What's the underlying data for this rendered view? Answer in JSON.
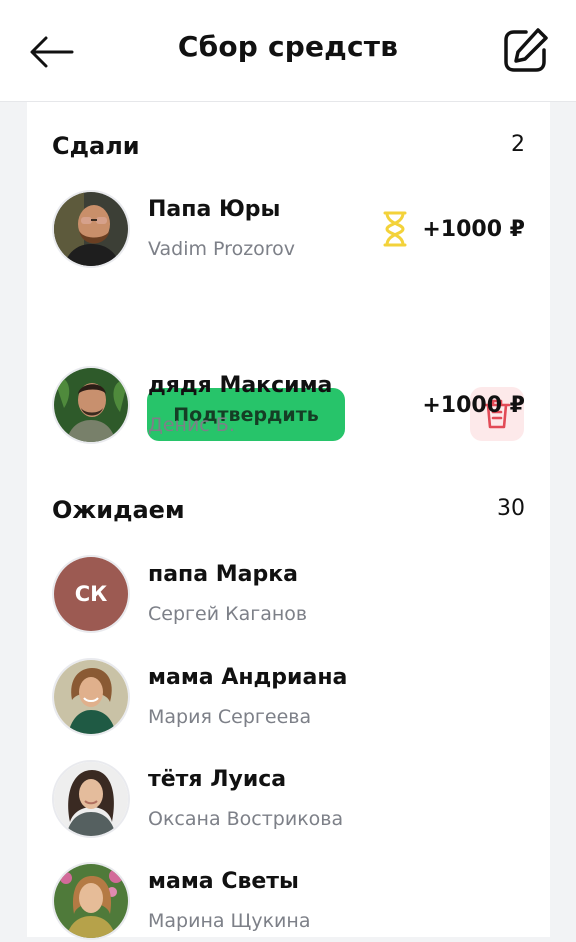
{
  "header": {
    "title": "Сбор средств",
    "back_icon": "arrow-left-icon",
    "edit_icon": "edit-icon"
  },
  "sections": {
    "paid": {
      "title": "Сдали",
      "count": "2",
      "items": [
        {
          "name": "Папа Юры",
          "sub": "Vadim Prozorov",
          "amount": "+1000 ₽",
          "status_icon": "hourglass-icon",
          "confirm_label": "Подтвердить",
          "delete_icon": "trash-icon"
        },
        {
          "name": "дядя Максима",
          "sub": "Денис Б.",
          "amount": "+1000 ₽"
        }
      ]
    },
    "waiting": {
      "title": "Ожидаем",
      "count": "30",
      "items": [
        {
          "name": "папа Марка",
          "sub": "Сергей Каганов",
          "initials": "СК"
        },
        {
          "name": "мама Андриана",
          "sub": "Мария Сергеева"
        },
        {
          "name": "тётя Луиса",
          "sub": "Оксана Вострикова"
        },
        {
          "name": "мама Светы",
          "sub": "Марина Щукина"
        }
      ]
    }
  },
  "colors": {
    "accent_green": "#27c46a",
    "danger_red": "#e24b57",
    "pending_yellow": "#f3d23a",
    "initials_bg": "#9c5a52"
  }
}
